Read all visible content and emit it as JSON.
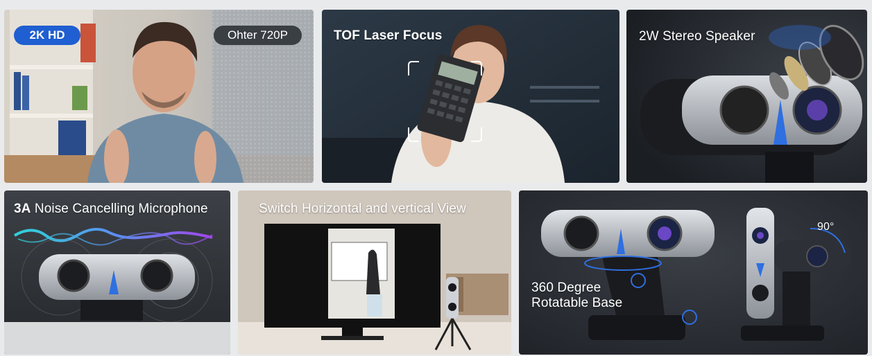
{
  "tiles": {
    "resolution": {
      "badge_primary": "2K HD",
      "badge_secondary": "Ohter 720P"
    },
    "focus": {
      "title": "TOF Laser Focus"
    },
    "speaker": {
      "title": "2W Stereo Speaker"
    },
    "microphone": {
      "title_bold": "3A",
      "title_rest": " Noise Cancelling Microphone"
    },
    "switch_view": {
      "title": "Switch Horizontal and vertical View"
    },
    "rotation": {
      "title_line1": "360 Degree",
      "title_line2": "Rotatable Base",
      "angle": "90°"
    }
  },
  "colors": {
    "background": "#e9eaec",
    "badge_blue": "#1f5fd1",
    "badge_gray": "#3a3f44",
    "accent_blue": "#2f6fe0"
  }
}
